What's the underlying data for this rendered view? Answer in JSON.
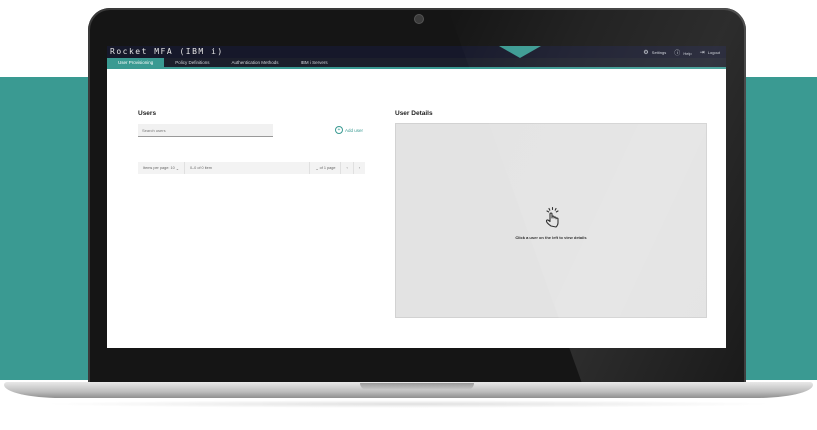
{
  "app": {
    "title": "Rocket MFA (IBM i)",
    "accent_color": "#3a9a92",
    "topbar_color": "#16182a"
  },
  "top_actions": [
    {
      "icon": "gear-icon",
      "label": "Settings"
    },
    {
      "icon": "help-icon",
      "label": "Help"
    },
    {
      "icon": "logout-icon",
      "label": "Logout"
    }
  ],
  "tabs": [
    {
      "label": "User Provisioning",
      "active": true
    },
    {
      "label": "Policy Definitions",
      "active": false
    },
    {
      "label": "Authentication Methods",
      "active": false
    },
    {
      "label": "IBM i Servers",
      "active": false
    }
  ],
  "users": {
    "title": "Users",
    "search_placeholder": "Search users",
    "add_user_label": "Add user"
  },
  "pager": {
    "items_per_page_label": "Items per page:",
    "items_per_page_value": "10",
    "range_text": "0–0 of 0 item",
    "page_text": "of 1 page"
  },
  "details": {
    "title": "User Details",
    "empty_message": "Click a user on the left to view details",
    "icon": "hand-pointer-icon"
  }
}
